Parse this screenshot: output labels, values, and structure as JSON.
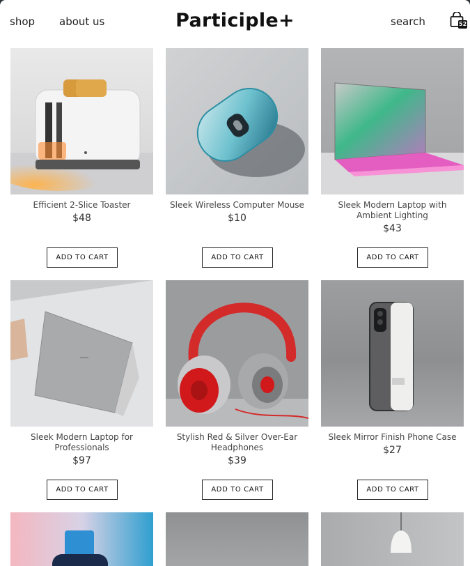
{
  "header": {
    "nav_shop": "shop",
    "nav_about": "about us",
    "brand": "Participle+",
    "nav_search": "search",
    "cart_count": "52"
  },
  "products": [
    {
      "name": "Efficient 2-Slice Toaster",
      "price": "$48",
      "button": "ADD TO CART"
    },
    {
      "name": "Sleek Wireless Computer Mouse",
      "price": "$10",
      "button": "ADD TO CART"
    },
    {
      "name": "Sleek Modern Laptop with Ambient Lighting",
      "price": "$43",
      "button": "ADD TO CART"
    },
    {
      "name": "Sleek Modern Laptop for Professionals",
      "price": "$97",
      "button": "ADD TO CART"
    },
    {
      "name": "Stylish Red & Silver Over-Ear Headphones",
      "price": "$39",
      "button": "ADD TO CART"
    },
    {
      "name": "Sleek Mirror Finish Phone Case",
      "price": "$27",
      "button": "ADD TO CART"
    }
  ],
  "colors": {
    "accent": "#111111",
    "window_bg": "#2e3338"
  }
}
